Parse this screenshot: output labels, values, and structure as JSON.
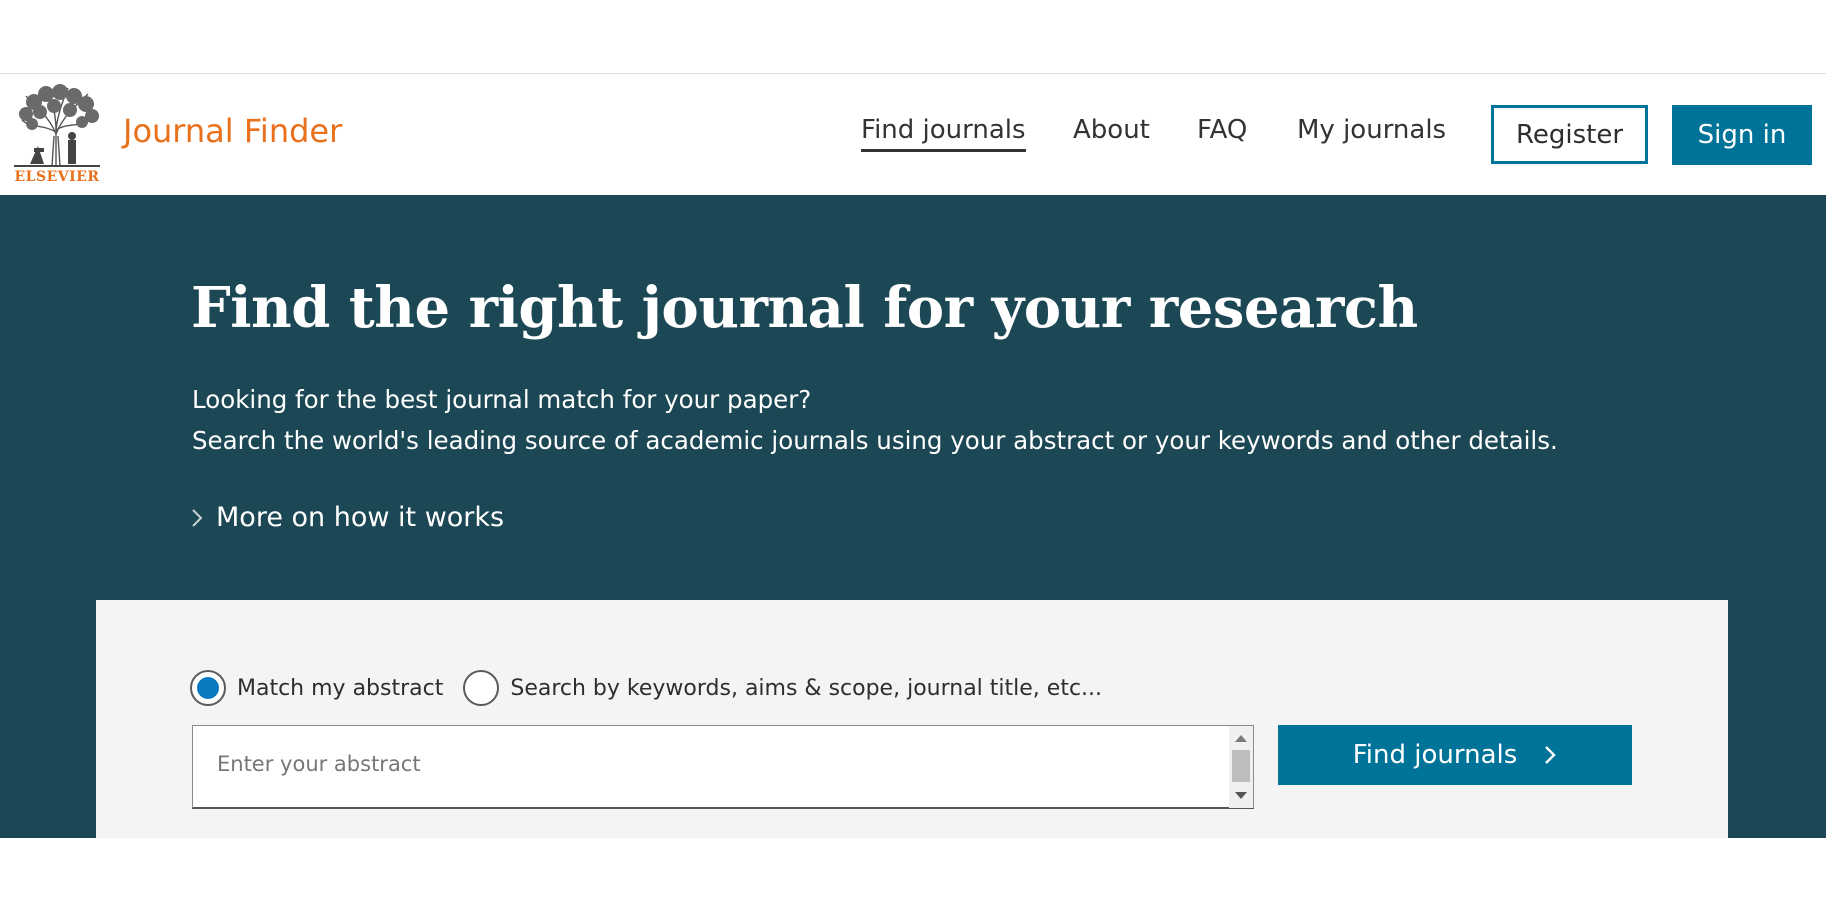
{
  "brand": {
    "logo_text": "ELSEVIER",
    "app_title": "Journal Finder",
    "accent_orange": "#e9711c",
    "accent_blue": "#007398",
    "hero_background": "#1c4755"
  },
  "nav": {
    "items": [
      {
        "label": "Find journals",
        "active": true
      },
      {
        "label": "About"
      },
      {
        "label": "FAQ"
      },
      {
        "label": "My journals"
      }
    ],
    "register_label": "Register",
    "signin_label": "Sign in"
  },
  "hero": {
    "title": "Find the right journal for your research",
    "line1": "Looking for the best journal match for your paper?",
    "line2": "Search the world's leading source of academic journals using your abstract or your keywords and other details.",
    "more_link": "More on how it works"
  },
  "search": {
    "options": [
      {
        "label": "Match my abstract",
        "selected": true
      },
      {
        "label": "Search by keywords, aims & scope, journal title, etc...",
        "selected": false
      }
    ],
    "abstract_value": "",
    "abstract_placeholder": "Enter your abstract",
    "submit_label": "Find journals",
    "submit_icon": "chevron-right-icon"
  }
}
